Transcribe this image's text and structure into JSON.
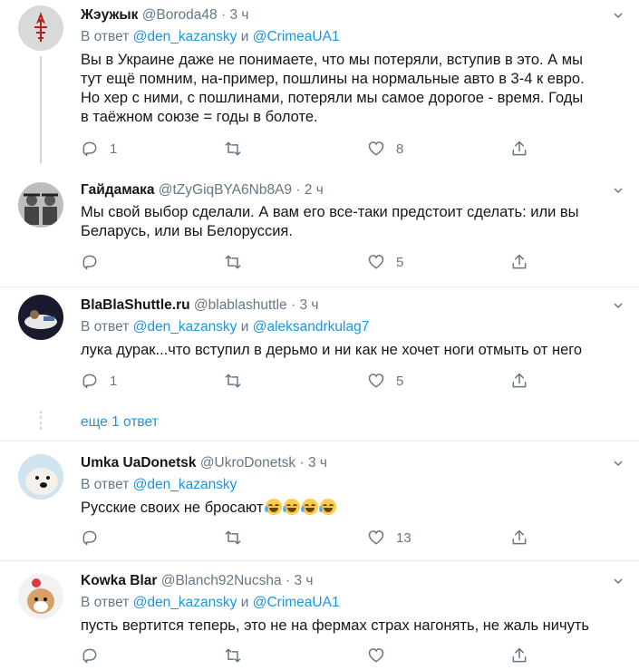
{
  "tweets": [
    {
      "name": "Жэужык",
      "handle": "@Boroda48",
      "sep": "·",
      "time": "3 ч",
      "reply_prefix": "В ответ",
      "reply_to_1": "@den_kazansky",
      "reply_and": "и",
      "reply_to_2": "@CrimeaUA1",
      "lines": [
        "Вы в Украине даже не понимаете, что мы потеряли, вступив в это. А мы",
        "тут ещё помним, на-пример, пошлины на нормальные авто в 3-4 к евро.",
        "Но хер с ними, с пошлинами, потеряли мы самое дорогое - время. Годы",
        "в таёжном союзе = годы в болоте."
      ],
      "replies": "1",
      "retweets": "",
      "likes": "8"
    },
    {
      "name": "Гайдамака",
      "handle": "@tZyGiqBYA6Nb8A9",
      "sep": "·",
      "time": "2 ч",
      "lines": [
        "Мы свой выбор сделали. А вам его все-таки предстоит сделать: или вы",
        "Беларусь, или вы Белоруссия."
      ],
      "replies": "",
      "retweets": "",
      "likes": "5"
    },
    {
      "name": "BlaBlaShuttle.ru",
      "handle": "@blablashuttle",
      "sep": "·",
      "time": "3 ч",
      "reply_prefix": "В ответ",
      "reply_to_1": "@den_kazansky",
      "reply_and": "и",
      "reply_to_2": "@aleksandrkulag7",
      "lines": [
        "лука дурак...что вступил в дерьмо  и  ни как не хочет ноги отмыть от него"
      ],
      "replies": "1",
      "retweets": "",
      "likes": "5"
    },
    {
      "name": "Umka UaDonetsk",
      "handle": "@UkroDonetsk",
      "sep": "·",
      "time": "3 ч",
      "reply_prefix": "В ответ",
      "reply_to_1": "@den_kazansky",
      "lines": [
        "Русские своих не бросают"
      ],
      "replies": "",
      "retweets": "",
      "likes": "13"
    },
    {
      "name": "Kowka Blar",
      "handle": "@Blanch92Nucsha",
      "sep": "·",
      "time": "3 ч",
      "reply_prefix": "В ответ",
      "reply_to_1": "@den_kazansky",
      "reply_and": "и",
      "reply_to_2": "@CrimeaUA1",
      "lines": [
        "пусть вертится теперь, это не на фермах страх нагонять, не жаль ничуть"
      ],
      "replies": "",
      "retweets": "",
      "likes": ""
    }
  ],
  "show_more": "еще 1 ответ",
  "icons": {
    "reply": "reply-icon",
    "retweet": "retweet-icon",
    "like": "heart-icon",
    "share": "share-icon",
    "caret": "chevron-down-icon",
    "emoji": "crying-laughing-emoji"
  },
  "colors": {
    "link": "#1b95e0",
    "secondary": "#657786",
    "text": "#14171a",
    "divider": "#e6ecf0"
  }
}
